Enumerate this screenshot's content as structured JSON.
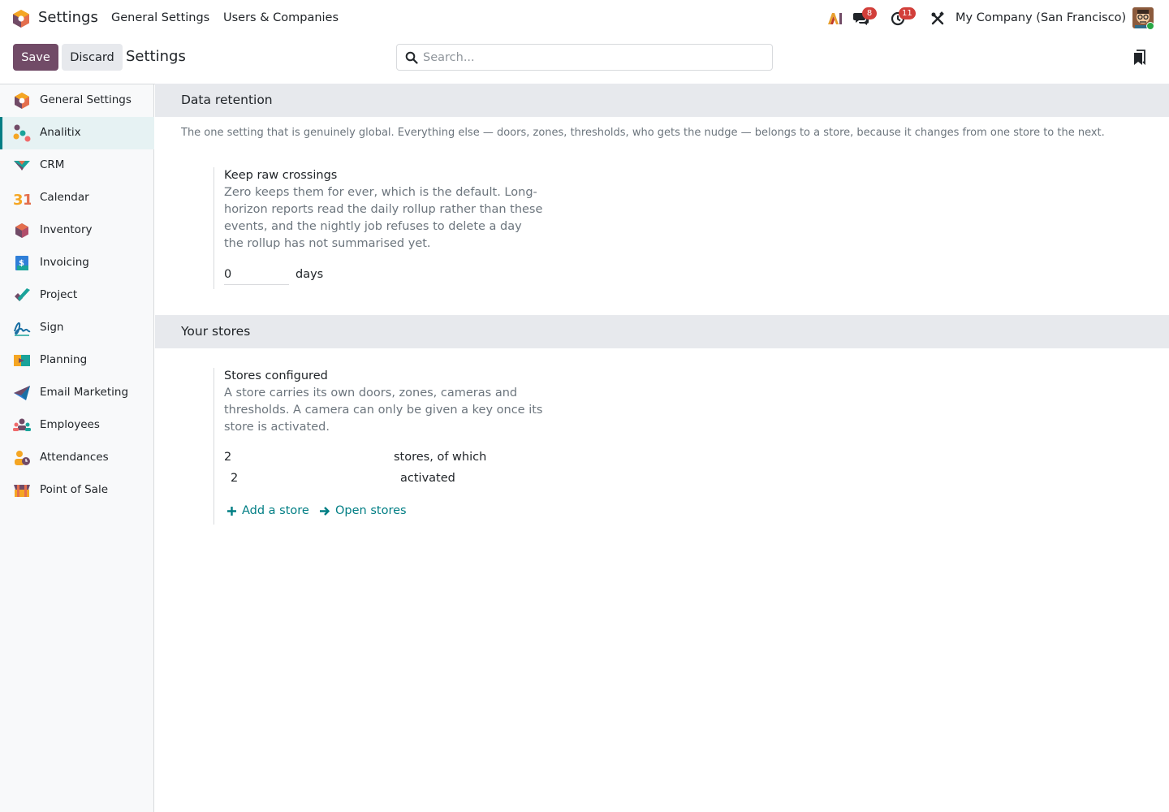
{
  "navbar": {
    "app_title": "Settings",
    "menu": [
      "General Settings",
      "Users & Companies"
    ],
    "company": "My Company (San Francisco)",
    "messages_count": "8",
    "activities_count": "11"
  },
  "control_panel": {
    "save_label": "Save",
    "discard_label": "Discard",
    "breadcrumb": "Settings",
    "search_placeholder": "Search..."
  },
  "sidebar": {
    "items": [
      {
        "label": "General Settings",
        "icon": "odoo-logo-icon"
      },
      {
        "label": "Analitix",
        "icon": "analitix-icon",
        "active": true
      },
      {
        "label": "CRM",
        "icon": "crm-icon"
      },
      {
        "label": "Calendar",
        "icon": "calendar-icon"
      },
      {
        "label": "Inventory",
        "icon": "inventory-icon"
      },
      {
        "label": "Invoicing",
        "icon": "invoicing-icon"
      },
      {
        "label": "Project",
        "icon": "project-icon"
      },
      {
        "label": "Sign",
        "icon": "sign-icon"
      },
      {
        "label": "Planning",
        "icon": "planning-icon"
      },
      {
        "label": "Email Marketing",
        "icon": "email-marketing-icon"
      },
      {
        "label": "Employees",
        "icon": "employees-icon"
      },
      {
        "label": "Attendances",
        "icon": "attendances-icon"
      },
      {
        "label": "Point of Sale",
        "icon": "point-of-sale-icon"
      }
    ]
  },
  "data_retention": {
    "title": "Data retention",
    "description": "The one setting that is genuinely global. Everything else — doors, zones, thresholds, who gets the nudge — belongs to a store, because it changes from one store to the next.",
    "setting_title": "Keep raw crossings",
    "setting_help": "Zero keeps them for ever, which is the default. Long-horizon reports read the daily rollup rather than these events, and the nightly job refuses to delete a day the rollup has not summarised yet.",
    "value": "0",
    "unit": "days"
  },
  "stores": {
    "title": "Your stores",
    "setting_title": "Stores configured",
    "setting_help": "A store carries its own doors, zones, cameras and thresholds. A camera can only be given a key once its store is activated.",
    "stores_count": "2",
    "stores_label": "stores, of which",
    "activated_count": "2",
    "activated_label": "activated",
    "add_store": "Add a store",
    "open_stores": "Open stores"
  },
  "colors": {
    "brand": "#714b67",
    "accent": "#017e84",
    "badge": "#d23f3a"
  }
}
